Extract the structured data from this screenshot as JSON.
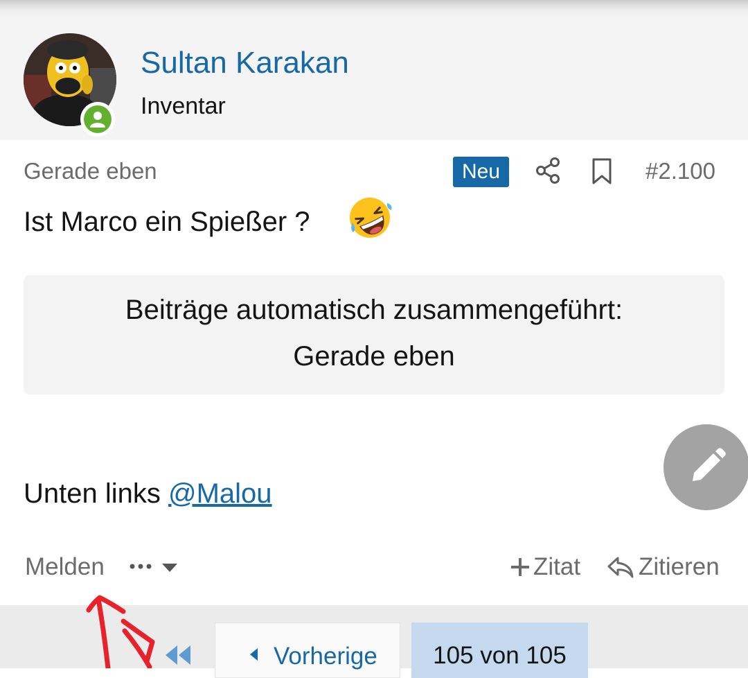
{
  "user": {
    "name": "Sultan Karakan",
    "title": "Inventar"
  },
  "post": {
    "time": "Gerade eben",
    "badge": "Neu",
    "number": "#2.100",
    "text1": "Ist Marco ein Spießer ?",
    "emoji": "rolling-on-floor-laughing-emoji",
    "merge_line1": "Beiträge automatisch zusammengeführt:",
    "merge_line2": "Gerade eben",
    "text2_prefix": "Unten links ",
    "mention": "@Malou"
  },
  "actions": {
    "report": "Melden",
    "quote_add": "Zitat",
    "reply": "Zitieren"
  },
  "pagination": {
    "prev_label": "Vorherige",
    "page_indicator": "105 von 105"
  },
  "colors": {
    "link": "#1669a6",
    "online": "#63b02e",
    "annotation": "#e8222b"
  }
}
